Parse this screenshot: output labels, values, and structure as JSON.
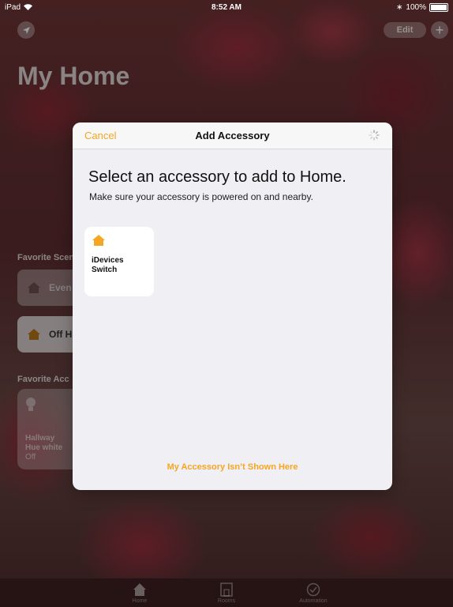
{
  "status_bar": {
    "carrier": "iPad",
    "time": "8:52 AM",
    "battery": "100%"
  },
  "home": {
    "title": "My Home",
    "edit_label": "Edit",
    "add_label": "+",
    "favorite_scenes_label": "Favorite Scen",
    "scenes": [
      {
        "label": "Even",
        "state": "dimmed"
      },
      {
        "label": "Off H",
        "state": "active"
      }
    ],
    "favorite_accessories_label": "Favorite Acc",
    "accessory": {
      "name_line1": "Hallway",
      "name_line2": "Hue white",
      "status": "Off"
    }
  },
  "tabbar": {
    "tabs": [
      {
        "label": "Home",
        "icon": "home-icon"
      },
      {
        "label": "Rooms",
        "icon": "rooms-icon"
      },
      {
        "label": "Automation",
        "icon": "automation-icon"
      }
    ]
  },
  "modal": {
    "cancel_label": "Cancel",
    "title": "Add Accessory",
    "heading": "Select an accessory to add to Home.",
    "subheading": "Make sure your accessory is powered on and nearby.",
    "devices": [
      {
        "name": "iDevices Switch",
        "icon": "house-icon"
      }
    ],
    "not_shown_label": "My Accessory Isn’t Shown Here"
  },
  "colors": {
    "accent": "#f5a623",
    "modal_bg": "#efeff4",
    "card_bg": "#ffffff"
  }
}
